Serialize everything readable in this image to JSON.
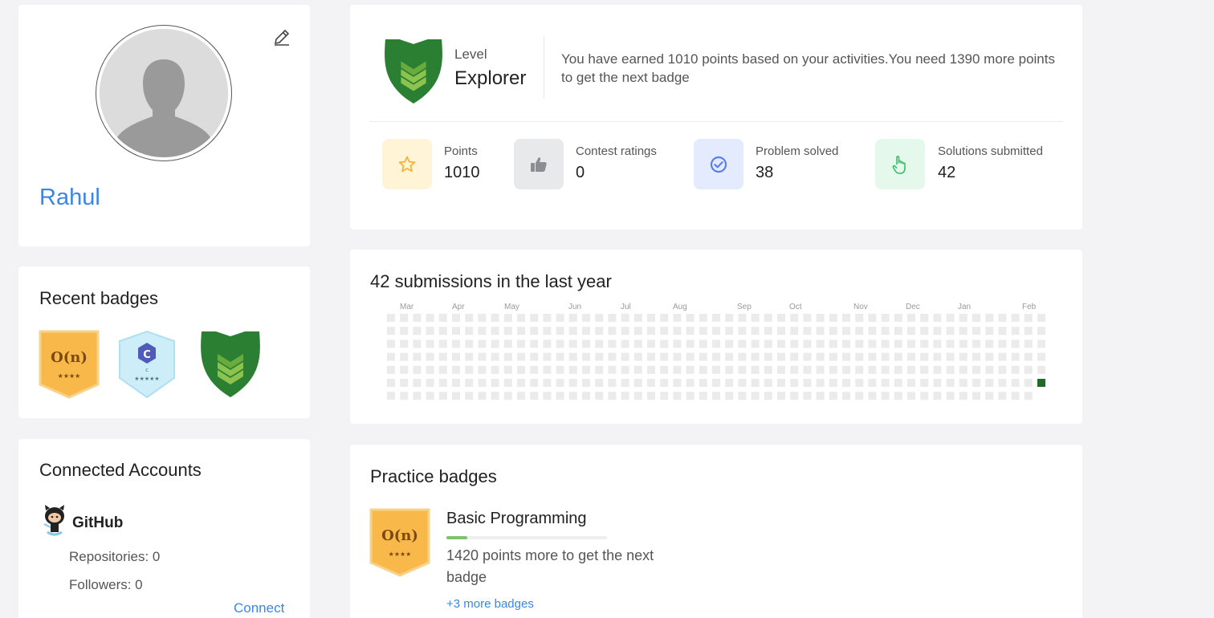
{
  "profile": {
    "name": "Rahul"
  },
  "recent_badges": {
    "title": "Recent badges",
    "items": [
      {
        "icon": "big-o-badge-icon",
        "symbol": "O(n)",
        "stars": "★★★★",
        "color": "#f9b94a"
      },
      {
        "icon": "c-language-badge-icon",
        "symbol": "C",
        "sub": "c",
        "stars": "★★★★★",
        "color": "#cdeef8"
      },
      {
        "icon": "explorer-shield-badge-icon",
        "color": "#2a7f33"
      }
    ]
  },
  "connected_accounts": {
    "title": "Connected Accounts",
    "github": {
      "name": "GitHub",
      "icon": "github-octocat-icon",
      "repositories": "Repositories: 0",
      "followers": "Followers: 0",
      "connect": "Connect"
    }
  },
  "level": {
    "label": "Level",
    "name": "Explorer",
    "message": "You have earned 1010 points based on your activities.You need 1390 more points to get the next badge",
    "stats": [
      {
        "label": "Points",
        "value": "1010",
        "icon": "star-icon",
        "bg": "#fff4d6",
        "fg": "#f2b33a"
      },
      {
        "label": "Contest ratings",
        "value": "0",
        "icon": "thumbs-up-icon",
        "bg": "#e8e9eb",
        "fg": "#8a8d91"
      },
      {
        "label": "Problem solved",
        "value": "38",
        "icon": "check-circle-icon",
        "bg": "#e4ebff",
        "fg": "#5b7fe8"
      },
      {
        "label": "Solutions submitted",
        "value": "42",
        "icon": "pointer-hand-icon",
        "bg": "#e5f8ec",
        "fg": "#3dbb6a"
      }
    ]
  },
  "submissions": {
    "title": "42 submissions in the last year",
    "months": [
      "Mar",
      "Apr",
      "May",
      "Jun",
      "Jul",
      "Aug",
      "Sep",
      "Oct",
      "Nov",
      "Dec",
      "Jan",
      "Feb"
    ],
    "active_color": "#1e6b25",
    "empty_color": "#ebebeb"
  },
  "practice_badges": {
    "title": "Practice badges",
    "item": {
      "name": "Basic Programming",
      "progress": 0.13,
      "desc": "1420 points more to get the next badge",
      "symbol": "O(n)",
      "stars": "★★★★"
    },
    "more": "+3 more badges"
  }
}
